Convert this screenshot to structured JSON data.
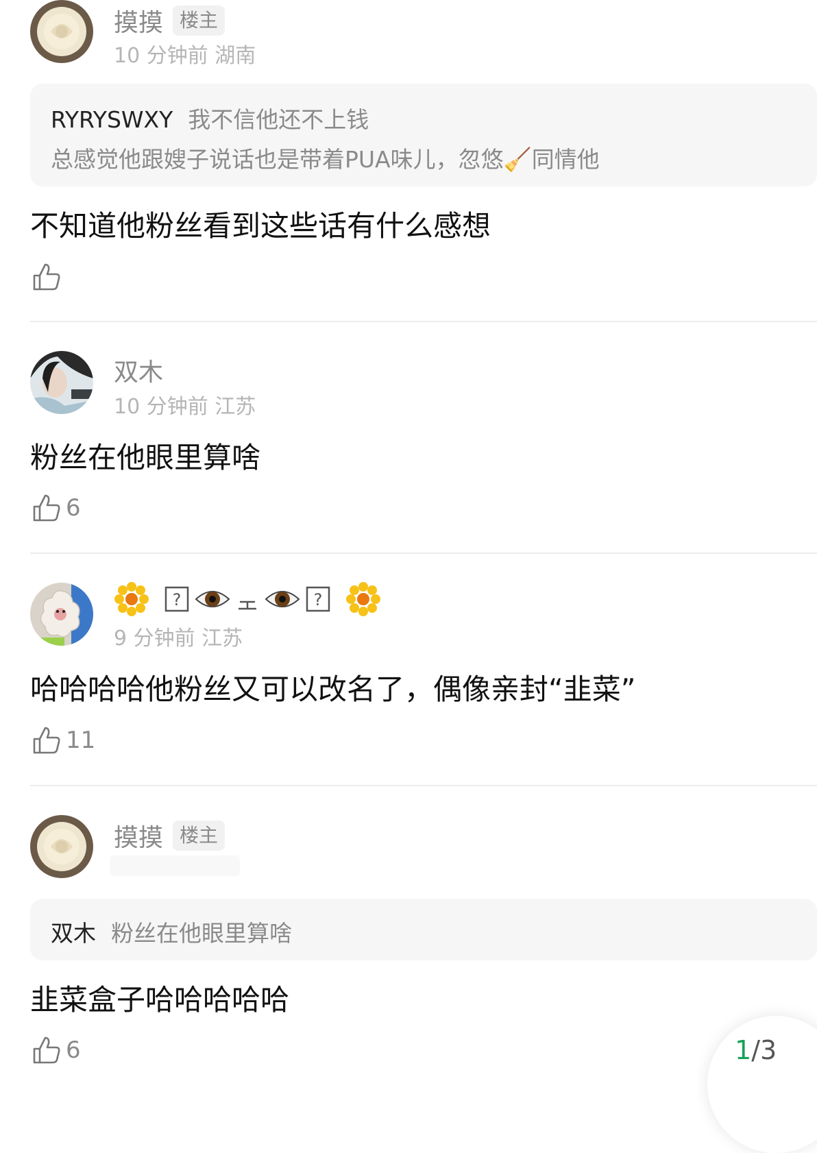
{
  "colors": {
    "accent_green": "#18a058",
    "muted": "#8a8a8a",
    "meta": "#b5b5b5",
    "quote_bg": "#f6f6f6"
  },
  "comments": [
    {
      "username": "摸摸",
      "badge": "楼主",
      "time_location": "10 分钟前 湖南",
      "quote": {
        "author": "RYRYSWXY",
        "line1": "我不信他还不上钱",
        "line2": "总感觉他跟嫂子说话也是带着PUA味儿，忽悠🧹同情他"
      },
      "text": "不知道他粉丝看到这些话有什么感想",
      "likes": ""
    },
    {
      "username": "双木",
      "time_location": "10 分钟前 江苏",
      "text": "粉丝在他眼里算啥",
      "likes": "6"
    },
    {
      "username_icons": [
        "sunflower-icon",
        "unknown-char-icon",
        "eye-icon",
        "mouth-icon",
        "eye-icon",
        "unknown-char-icon",
        "sunflower-icon"
      ],
      "time_location": "9 分钟前 江苏",
      "text": "哈哈哈哈他粉丝又可以改名了，偶像亲封“韭菜”",
      "likes": "11"
    },
    {
      "username": "摸摸",
      "badge": "楼主",
      "quote": {
        "author": "双木",
        "line1": "粉丝在他眼里算啥"
      },
      "text": "韭菜盒子哈哈哈哈哈",
      "likes": "6"
    }
  ],
  "pager": {
    "current": "1",
    "total": "/3"
  }
}
